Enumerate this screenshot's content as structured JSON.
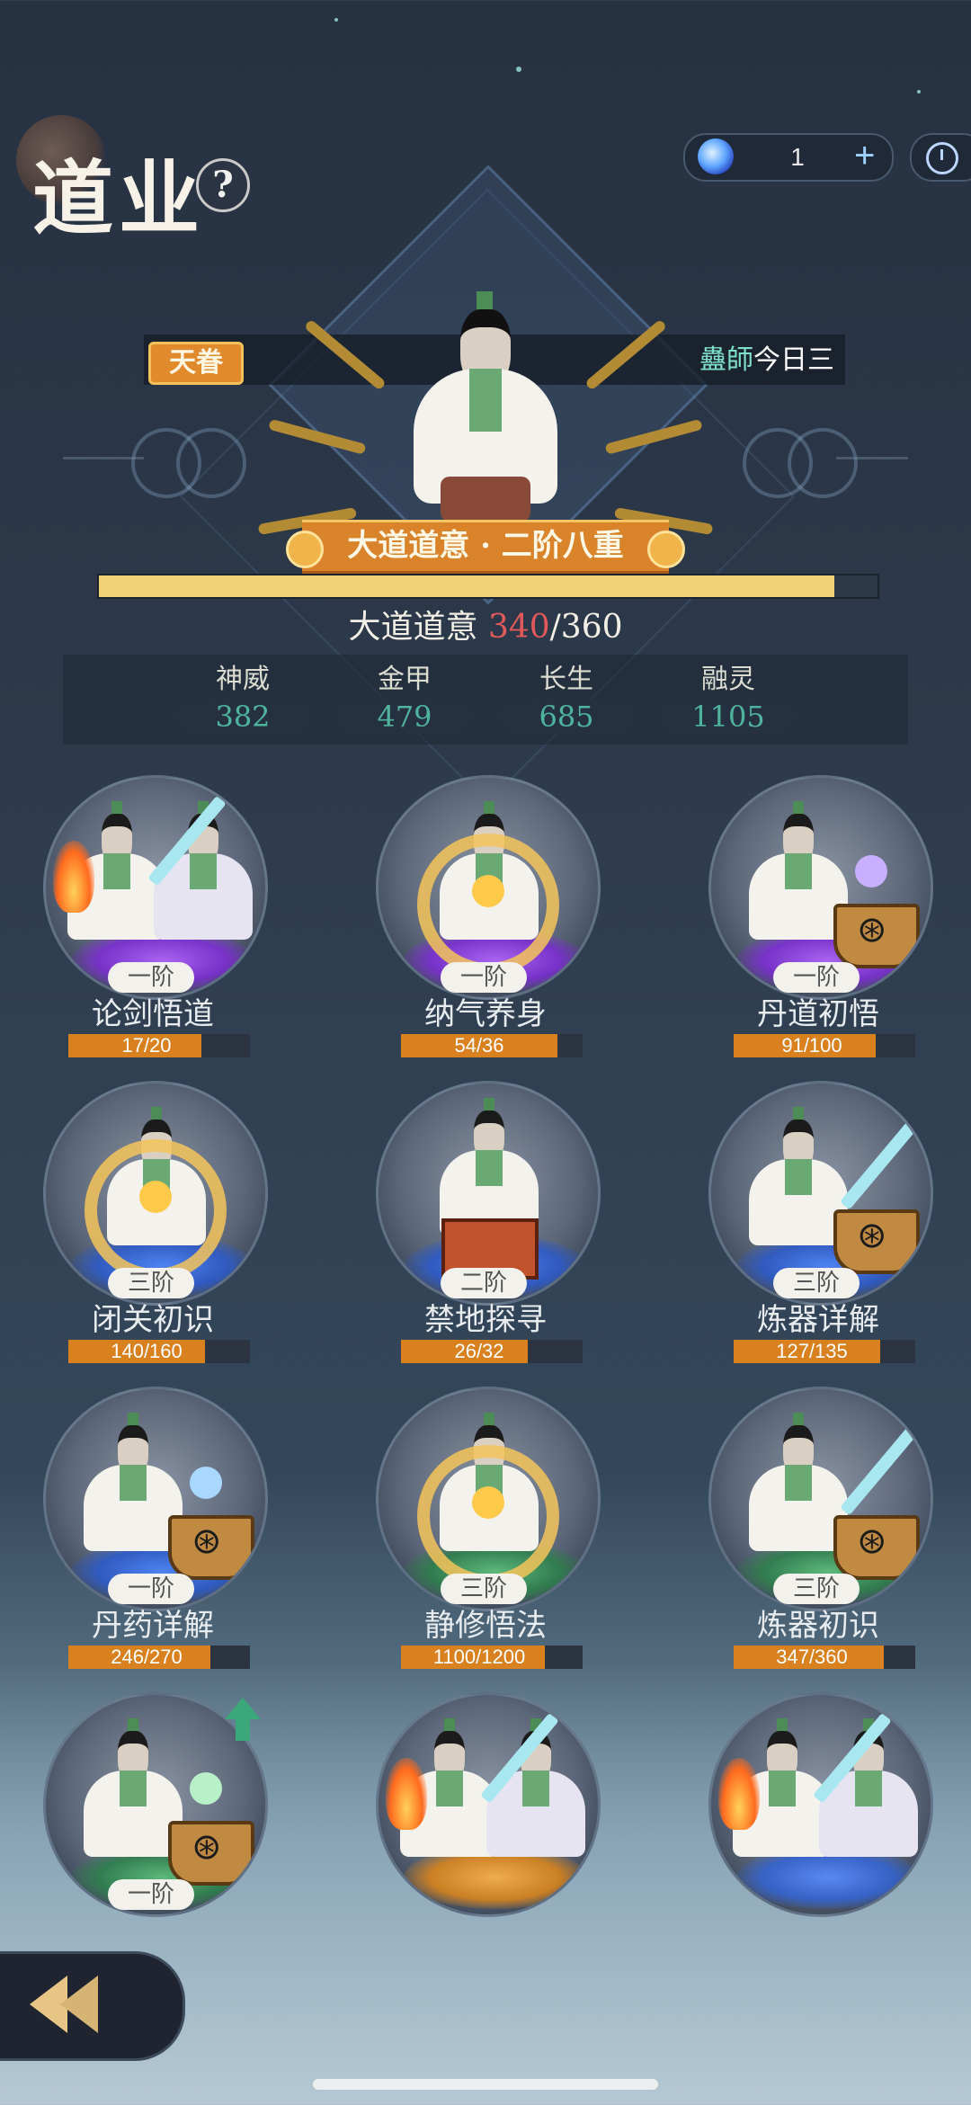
{
  "header": {
    "title": "道业",
    "help_label": "?",
    "currency": {
      "amount": "1",
      "add_label": "+"
    }
  },
  "banner": {
    "tag": "天眷",
    "scroll_prefix": "蠱師",
    "scroll_text": "今日三"
  },
  "rank": {
    "title": "大道道意 · 二阶八重",
    "progress_label": "大道道意",
    "current": 340,
    "max": 360,
    "separator": "/"
  },
  "stats": [
    {
      "label": "神威",
      "value": "382"
    },
    {
      "label": "金甲",
      "value": "479"
    },
    {
      "label": "长生",
      "value": "685"
    },
    {
      "label": "融灵",
      "value": "1105"
    }
  ],
  "skills": [
    {
      "name": "论剑悟道",
      "tier": "一阶",
      "progress": "17/20",
      "fraction": 0.85,
      "glow": "purple",
      "art": "duel"
    },
    {
      "name": "纳气养身",
      "tier": "一阶",
      "progress": "54/36",
      "fraction": 1.0,
      "glow": "purple",
      "art": "ring"
    },
    {
      "name": "丹道初悟",
      "tier": "一阶",
      "progress": "91/100",
      "fraction": 0.91,
      "glow": "purple",
      "art": "cauldron",
      "orb": "#c9b0ff"
    },
    {
      "name": "闭关初识",
      "tier": "三阶",
      "progress": "140/160",
      "fraction": 0.875,
      "glow": "blue",
      "art": "ring"
    },
    {
      "name": "禁地探寻",
      "tier": "二阶",
      "progress": "26/32",
      "fraction": 0.81,
      "glow": "blue",
      "art": "chest"
    },
    {
      "name": "炼器详解",
      "tier": "三阶",
      "progress": "127/135",
      "fraction": 0.94,
      "glow": "blue",
      "art": "blade"
    },
    {
      "name": "丹药详解",
      "tier": "一阶",
      "progress": "246/270",
      "fraction": 0.91,
      "glow": "blue",
      "art": "cauldron",
      "orb": "#a8d8ff"
    },
    {
      "name": "静修悟法",
      "tier": "三阶",
      "progress": "1100/1200",
      "fraction": 0.92,
      "glow": "green",
      "art": "ring"
    },
    {
      "name": "炼器初识",
      "tier": "三阶",
      "progress": "347/360",
      "fraction": 0.96,
      "glow": "green",
      "art": "blade"
    },
    {
      "name": "",
      "tier": "一阶",
      "progress": "",
      "fraction": 0,
      "glow": "green",
      "art": "cauldron",
      "orb": "#b8f0c8",
      "upgrade": true
    },
    {
      "name": "",
      "tier": "",
      "progress": "",
      "fraction": 0,
      "glow": "orange",
      "art": "duel"
    },
    {
      "name": "",
      "tier": "",
      "progress": "",
      "fraction": 0,
      "glow": "sky",
      "art": "duel"
    }
  ],
  "icons": {
    "gem": "spirit-gem-icon",
    "clock": "clock-icon",
    "back": "back-arrow-icon",
    "upgrade": "upgrade-arrow-icon"
  },
  "colors": {
    "accent_orange": "#d9832b",
    "stat_green": "#4fb49e",
    "progress_current": "#e2595a",
    "main_bar": "#f1d177"
  }
}
